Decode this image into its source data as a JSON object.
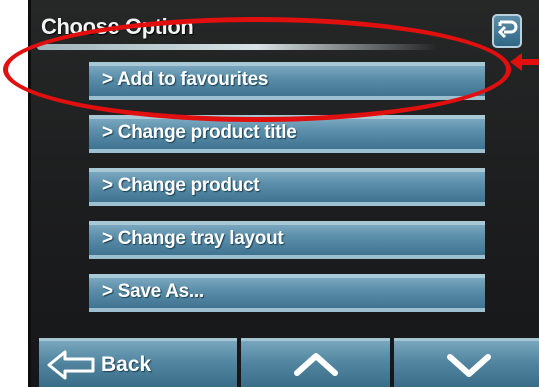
{
  "header": {
    "title": "Choose Option"
  },
  "menu": {
    "items": [
      {
        "label": "> Add to favourites"
      },
      {
        "label": "> Change product title"
      },
      {
        "label": "> Change product"
      },
      {
        "label": "> Change tray layout"
      },
      {
        "label": "> Save As..."
      }
    ]
  },
  "bottom_bar": {
    "back_label": "Back"
  },
  "icons": {
    "return": "return-arrow-icon",
    "back": "back-arrow-icon",
    "up": "chevron-up-icon",
    "down": "chevron-down-icon"
  },
  "colors": {
    "button_blue": "#5b8ea9",
    "annotation_red": "#e20f0f",
    "screen_bg": "#1c1d1e"
  }
}
